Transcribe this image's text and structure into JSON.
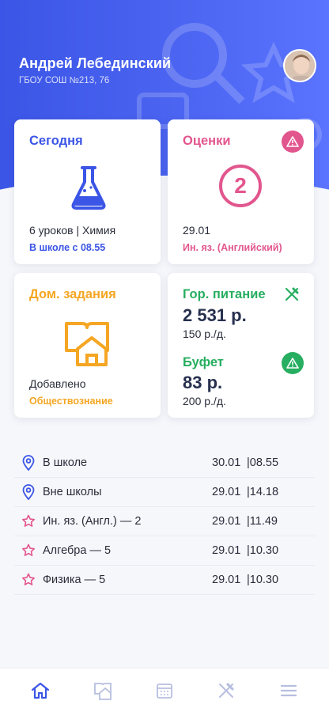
{
  "user": {
    "name": "Андрей Лебединский",
    "school": "ГБОУ СОШ №213, 76"
  },
  "cards": {
    "today": {
      "title": "Сегодня",
      "lessons": "6 уроков | Химия",
      "status": "В школе с 08.55"
    },
    "grades": {
      "title": "Оценки",
      "grade": "2",
      "date": "29.01",
      "subject": "Ин. яз. (Английский)"
    },
    "homework": {
      "title": "Дом. задания",
      "status": "Добавлено",
      "subject": "Обществознание"
    },
    "food": {
      "meal_title": "Гор. питание",
      "meal_amount": "2 531 р.",
      "meal_per_day": "150 р./д.",
      "buffet_title": "Буфет",
      "buffet_amount": "83 р.",
      "buffet_per_day": "200 р./д."
    }
  },
  "events": [
    {
      "icon": "location-pin-icon",
      "label": "В школе",
      "date": "30.01",
      "time": "|08.55"
    },
    {
      "icon": "location-pin-icon",
      "label": "Вне школы",
      "date": "29.01",
      "time": "|14.18"
    },
    {
      "icon": "star-icon",
      "label": "Ин. яз. (Англ.) — 2",
      "date": "29.01",
      "time": "|11.49"
    },
    {
      "icon": "star-icon",
      "label": "Алгебра — 5",
      "date": "29.01",
      "time": "|10.30"
    },
    {
      "icon": "star-icon",
      "label": "Физика — 5",
      "date": "29.01",
      "time": "|10.30"
    }
  ],
  "tabs": [
    "home-icon",
    "homework-icon",
    "calendar-icon",
    "food-icon",
    "menu-icon"
  ],
  "colors": {
    "primary": "#3b55e6",
    "grade_pink": "#e2568e",
    "homework_orange": "#f5a623",
    "food_green": "#27ae60",
    "text_dark": "#27304f"
  }
}
